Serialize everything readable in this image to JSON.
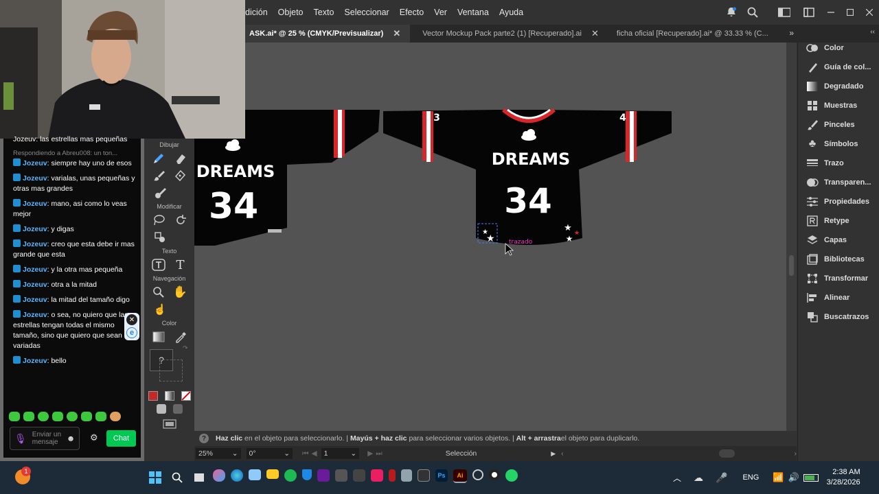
{
  "menu": [
    "dición",
    "Objeto",
    "Texto",
    "Seleccionar",
    "Efecto",
    "Ver",
    "Ventana",
    "Ayuda"
  ],
  "tabs": [
    {
      "label": "ASK.ai* @ 25 % (CMYK/Previsualizar)",
      "active": true
    },
    {
      "label": "Vector Mockup Pack parte2  (1) [Recuperado].ai",
      "active": false
    },
    {
      "label": "ficha oficial [Recuperado].ai* @ 33.33 % (C...",
      "active": false
    }
  ],
  "panels": [
    "Color",
    "Guía de col...",
    "Degradado",
    "Muestras",
    "Pinceles",
    "Símbolos",
    "Trazo",
    "Transparen...",
    "Propiedades",
    "Retype",
    "Capas",
    "Bibliotecas",
    "Transformar",
    "Alinear",
    "Buscatrazos"
  ],
  "toolbar": {
    "draw": "Dibujar",
    "modify": "Modificar",
    "text": "Texto",
    "nav": "Navegación",
    "color": "Color",
    "unknown": "?"
  },
  "jersey": {
    "brand": "DREAMS",
    "number": "34",
    "sleeve_left": "3",
    "sleeve_right": "4",
    "tooltip": "trazado"
  },
  "status": {
    "part1_b": "Haz clic",
    "part1": " en el objeto para seleccionarlo. | ",
    "part2_b": "Mayús + haz clic",
    "part2": " para seleccionar varios objetos. | ",
    "part3_b": "Alt + arrastra",
    "part3": " el objeto para duplicarlo."
  },
  "bottom": {
    "zoom": "25%",
    "angle": "0°",
    "page": "1",
    "tool": "Selección"
  },
  "chat": {
    "top_text": "Jozeuv: las estrellas mas pequeñas",
    "reply": "Respondiendo a Abreu008: un ton...",
    "messages": [
      {
        "user": "Jozeuv",
        "text": ": siempre hay uno de esos"
      },
      {
        "user": "Jozeuv",
        "text": ": varialas, unas pequeñas y otras mas grandes"
      },
      {
        "user": "Jozeuv",
        "text": ": mano, asi como lo veas mejor"
      },
      {
        "user": "Jozeuv",
        "text": ": y digas"
      },
      {
        "user": "Jozeuv",
        "text": ": creo que esta debe ir mas grande que esta"
      },
      {
        "user": "Jozeuv",
        "text": ": y la otra mas pequeña"
      },
      {
        "user": "Jozeuv",
        "text": ": otra a la mitad"
      },
      {
        "user": "Jozeuv",
        "text": ": la mitad del tamaño digo"
      },
      {
        "user": "Jozeuv",
        "text": ": o sea, no quiero que las estrellas tengan todas el mismo tamaño, sino que quiero que sean variadas"
      },
      {
        "user": "Jozeuv",
        "text": ": bello"
      }
    ],
    "input_placeholder": "Enviar un mensaje",
    "chat_button": "Chat",
    "side_badge": "e"
  },
  "taskbar": {
    "lang": "ENG",
    "time": "2:38 AM",
    "date": "3/28/2026",
    "badge": "1"
  },
  "colors": {
    "accent_purple": "#ff33cc",
    "chat_button": "#00c853",
    "user": "#58b6ff",
    "jersey_red": "#d9262b"
  }
}
